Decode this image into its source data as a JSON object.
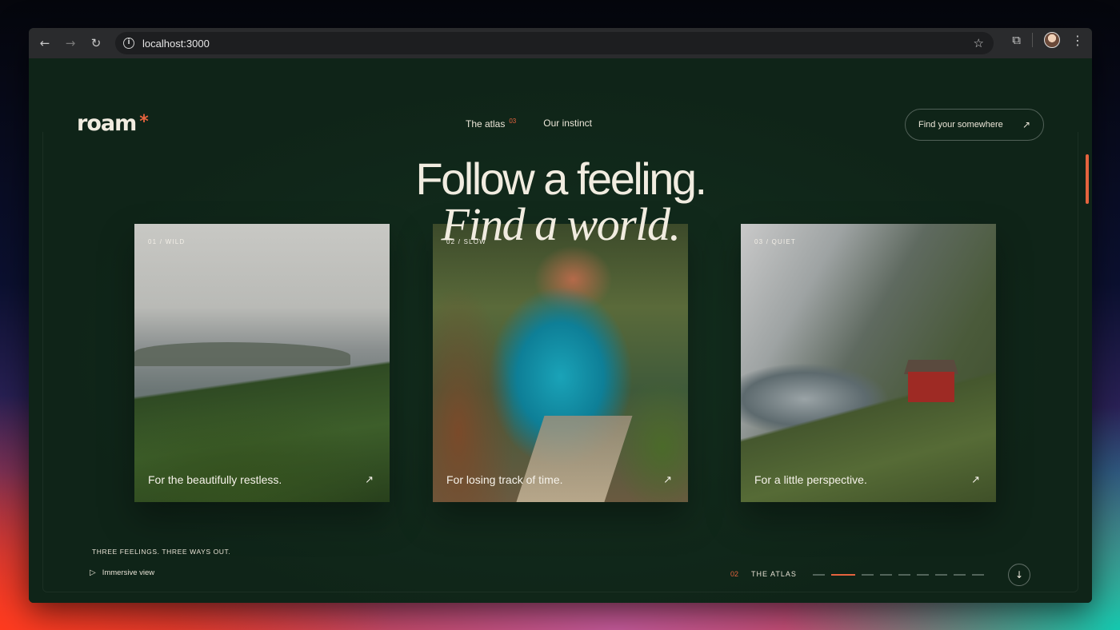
{
  "browser": {
    "url": "localhost:3000",
    "icons": {
      "back": "arrow-left-icon",
      "forward": "arrow-right-icon",
      "reload": "reload-icon",
      "info": "info-icon",
      "bookmark": "star-icon",
      "extensions": "puzzle-icon",
      "profile": "avatar",
      "menu": "kebab-icon"
    }
  },
  "site": {
    "logo": "roam",
    "logo_mark": "*",
    "nav": [
      {
        "label": "The atlas",
        "badge": "03"
      },
      {
        "label": "Our instinct"
      }
    ],
    "cta_label": "Find your somewhere",
    "accent_color": "#e5633e",
    "background_color": "#0f2418"
  },
  "hero": {
    "line1": "Follow a feeling.",
    "line2": "Find a world."
  },
  "cards": [
    {
      "tag": "01 / WILD",
      "caption": "For the beautifully restless."
    },
    {
      "tag": "02 / SLOW",
      "caption": "For losing track of time."
    },
    {
      "tag": "03 / QUIET",
      "caption": "For a little perspective."
    }
  ],
  "footer": {
    "eyebrow": "THREE FEELINGS. THREE WAYS OUT.",
    "immersive_label": "Immersive view",
    "section_number": "02",
    "section_label": "THE ATLAS",
    "progress": {
      "total": 10,
      "active_index": 1
    }
  }
}
